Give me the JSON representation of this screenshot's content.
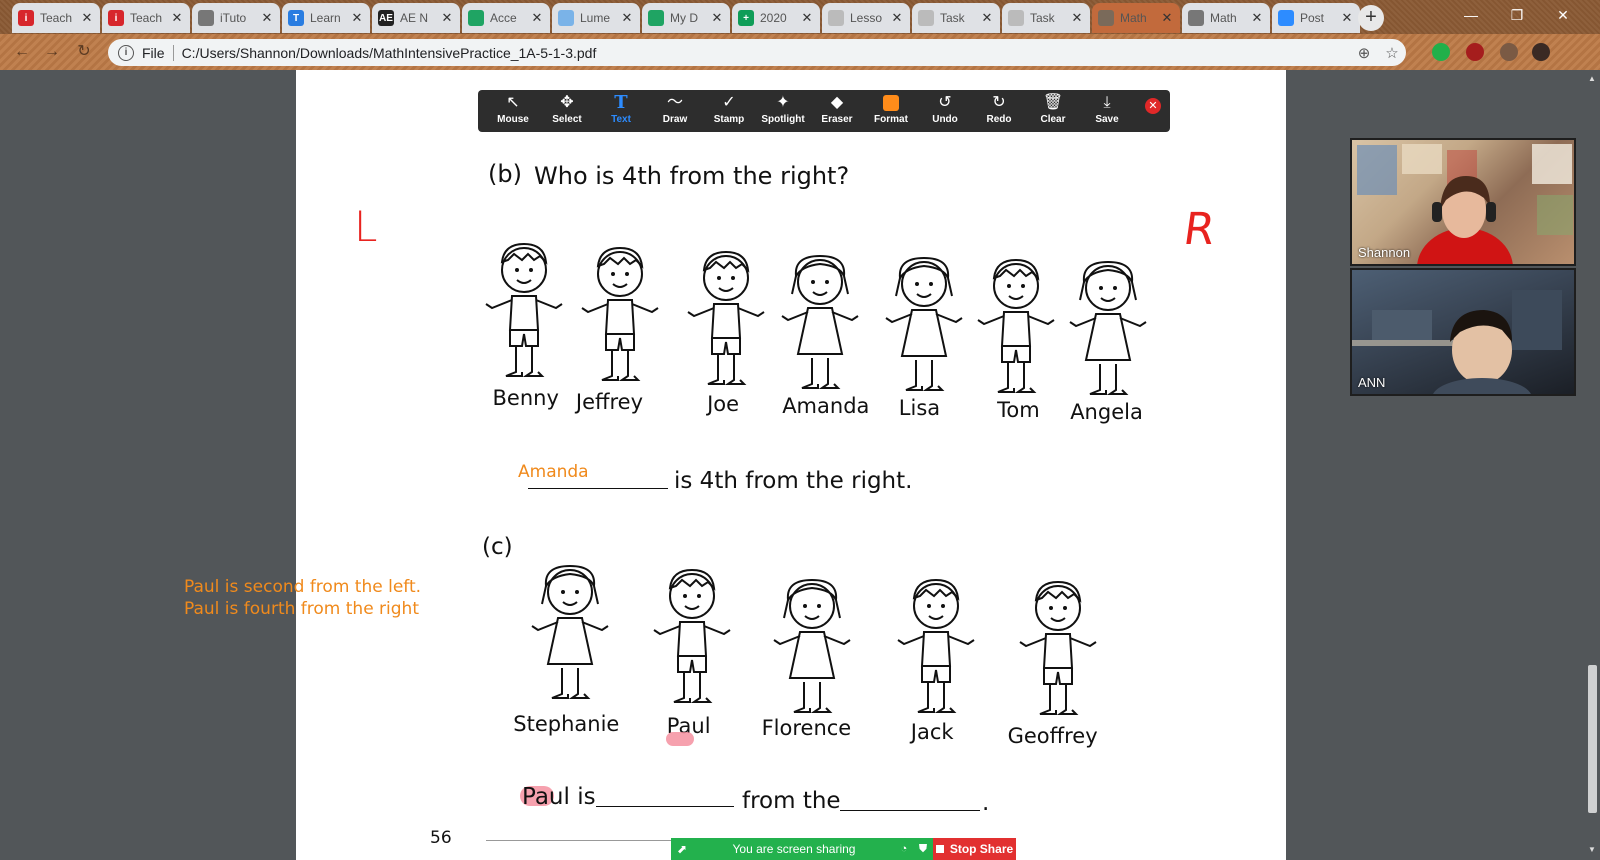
{
  "browser": {
    "tabs": [
      {
        "label": "Teach",
        "favicon_color": "#d7262c",
        "favicon_text": "i",
        "active": false
      },
      {
        "label": "Teach",
        "favicon_color": "#d7262c",
        "favicon_text": "i",
        "active": false
      },
      {
        "label": "iTuto",
        "favicon_color": "#777777",
        "favicon_text": "",
        "active": false
      },
      {
        "label": "Learn",
        "favicon_color": "#2a7de1",
        "favicon_text": "T",
        "active": false
      },
      {
        "label": "AE N",
        "favicon_color": "#222222",
        "favicon_text": "AE",
        "active": false
      },
      {
        "label": "Acce",
        "favicon_color": "#1fa463",
        "favicon_text": "",
        "active": false
      },
      {
        "label": "Lume",
        "favicon_color": "#7ab3e8",
        "favicon_text": "",
        "active": false
      },
      {
        "label": "My D",
        "favicon_color": "#1fa463",
        "favicon_text": "",
        "active": false
      },
      {
        "label": "2020",
        "favicon_color": "#0f9d58",
        "favicon_text": "+",
        "active": false
      },
      {
        "label": "Lesso",
        "favicon_color": "#bbbbbb",
        "favicon_text": "",
        "active": false
      },
      {
        "label": "Task",
        "favicon_color": "#bbbbbb",
        "favicon_text": "",
        "active": false
      },
      {
        "label": "Task",
        "favicon_color": "#bbbbbb",
        "favicon_text": "",
        "active": false
      },
      {
        "label": "Math",
        "favicon_color": "#7a6a5a",
        "favicon_text": "",
        "active": true
      },
      {
        "label": "Math",
        "favicon_color": "#777777",
        "favicon_text": "",
        "active": false
      },
      {
        "label": "Post",
        "favicon_color": "#2d8cff",
        "favicon_text": "",
        "active": false
      }
    ],
    "tab_close_glyph": "✕",
    "new_tab_glyph": "+",
    "window_controls": {
      "minimize": "—",
      "restore": "❐",
      "close": "✕"
    },
    "nav": {
      "back": "←",
      "forward": "→",
      "reload": "↻"
    },
    "omnibox": {
      "info_glyph": "i",
      "scheme_label": "File",
      "url": "C:/Users/Shannon/Downloads/MathIntensivePractice_1A-5-1-3.pdf",
      "zoom_glyph": "⊕",
      "star_glyph": "☆"
    },
    "extensions": [
      {
        "name": "green-extension-icon",
        "color": "#21b04a"
      },
      {
        "name": "ublock-extension-icon",
        "color": "#a51d1d"
      },
      {
        "name": "puzzle-extension-icon",
        "color": "#7a5a44"
      },
      {
        "name": "profile-avatar",
        "color": "#3a2a24"
      }
    ]
  },
  "annotate_toolbar": {
    "tools": [
      {
        "name": "mouse",
        "label": "Mouse",
        "icon": "↖",
        "selected": false
      },
      {
        "name": "select",
        "label": "Select",
        "icon": "✥",
        "selected": false
      },
      {
        "name": "text",
        "label": "Text",
        "icon": "T",
        "selected": true
      },
      {
        "name": "draw",
        "label": "Draw",
        "icon": "〜",
        "selected": false
      },
      {
        "name": "stamp",
        "label": "Stamp",
        "icon": "✓",
        "selected": false
      },
      {
        "name": "spotlight",
        "label": "Spotlight",
        "icon": "✦",
        "selected": false
      },
      {
        "name": "eraser",
        "label": "Eraser",
        "icon": "◆",
        "selected": false
      },
      {
        "name": "format",
        "label": "Format",
        "icon": "",
        "selected": false
      },
      {
        "name": "undo",
        "label": "Undo",
        "icon": "↺",
        "selected": false
      },
      {
        "name": "redo",
        "label": "Redo",
        "icon": "↻",
        "selected": false
      },
      {
        "name": "clear",
        "label": "Clear",
        "icon": "🗑",
        "selected": false
      },
      {
        "name": "save",
        "label": "Save",
        "icon": "⤓",
        "selected": false
      }
    ],
    "format_color": "#ff8c1a",
    "close_glyph": "✕"
  },
  "pdf": {
    "question_b": {
      "letter": "(b)",
      "text": "Who is 4th from the right?"
    },
    "question_b_names": [
      "Benny",
      "Jeffrey",
      "Joe",
      "Amanda",
      "Lisa",
      "Tom",
      "Angela"
    ],
    "answer_b_typed": "Amanda",
    "answer_b_suffix": "is 4th from the right.",
    "question_c": {
      "letter": "(c)"
    },
    "question_c_names": [
      "Stephanie",
      "Paul",
      "Florence",
      "Jack",
      "Geoffrey"
    ],
    "answer_c_prefix": "Paul is",
    "answer_c_middle": "from the",
    "answer_c_end": ".",
    "page_number": "56",
    "annotation_left_letter": "L",
    "annotation_right_letter": "R",
    "annotation_color": "#e8231f",
    "typed_color": "#f08a1c",
    "highlight_color": "#f48a9a"
  },
  "side_note": {
    "line1": "Paul is second from the left.",
    "line2": "Paul is fourth from the right"
  },
  "participants": [
    {
      "name": "Shannon"
    },
    {
      "name": "ANN"
    }
  ],
  "share_bar": {
    "status": "You are screen sharing",
    "stop_label": "Stop Share",
    "green": "#23b14d",
    "red": "#e23030"
  }
}
